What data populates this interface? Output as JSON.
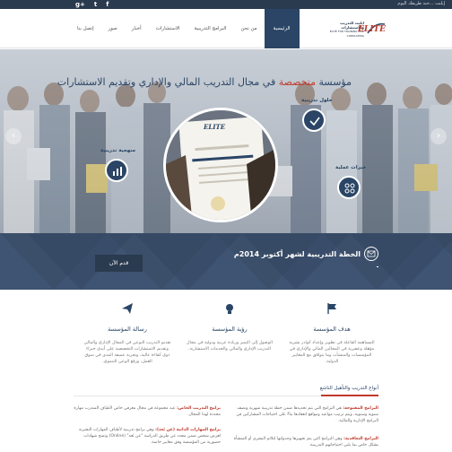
{
  "topbar": {
    "tagline": "إبلنت ...حند طريقك اليوم",
    "social": [
      "g+",
      "t",
      "f"
    ]
  },
  "header": {
    "logo_word": "ELITE",
    "logo_text_ar": "ايليت للتدريب والاستشارات",
    "logo_text_en": "ELITE FOR TRAINING AND CONSULTING"
  },
  "nav": {
    "items": [
      {
        "label": "الرئيسية",
        "active": true
      },
      {
        "label": "من نحن",
        "active": false
      },
      {
        "label": "البرامج التدريبية",
        "active": false
      },
      {
        "label": "الاستشارات",
        "active": false
      },
      {
        "label": "أخبار",
        "active": false
      },
      {
        "label": "صور",
        "active": false
      },
      {
        "label": "إتصل بنا",
        "active": false
      }
    ]
  },
  "hero": {
    "title_start": "مؤسسة ",
    "title_highlight": "متخصصة",
    "title_end": " في مجال التدريب المالي والإداري وتقديم الاستشارات",
    "features": {
      "solutions": "حلول تدريبية",
      "methodology": "منهجية تدريبية",
      "expertise": "خبرات عملية"
    },
    "prev": "‹",
    "next": "›",
    "cert_logo": "ELITE"
  },
  "band": {
    "title": "الخطة التدريبية لشهر أكتوبر 2014م",
    "button": "قدم الآن",
    "dash": "-"
  },
  "columns": [
    {
      "title": "هدف المؤسسة",
      "text": "المساهمة الفاعلة في تطوير وإعداد كوادر بشرية مؤهلة وعصرية في المجالين المالي والإداري في المؤسسات والمنشآت وما يتوافق مع المعايير الدولية."
    },
    {
      "title": "رؤية المؤسسة",
      "text": "الوصول إلى التميز وريادة عربية ودولية في مجال التدريب الإداري والمالي والخدمات الاستشارية."
    },
    {
      "title": "رسالة المؤسسة",
      "text": "تقديم التدريب النوعي في المجال الإداري والمالي وتقديم الاستشارات التخصصية على أيدي خبراء ذوي كفاءة عالية، وتجربة عميقة المدى في سوق العمل، ورفع الوعي التنموي."
    }
  ],
  "programs": {
    "title": "أنواع التدريب والتأهيل الناشع",
    "items": [
      {
        "name": "البرامج المفتوحة:",
        "text": "هي البرامج التي يتم تحديدها ضمن خطة تدريبية شهرية ونصف سنوية وسنوية، ويتم ترتيب مواعيد ومواقع انعقادها بناءً على احتياجات المشاركين في البرامج الإدارية والمالية."
      },
      {
        "name": "برامج التدريب الخاص:",
        "text": "عبد مجموعة في مجال معرفي خاص لأطياف المتدرب مهارة محددة لهذا المجال."
      },
      {
        "name": "البرامج التعاقدية:",
        "text": "وهي البرامج التي يتم تجهيزها وجدولتها لتلائم البشري أو المنشأة بشكل خاص بما يلبي احتياجاتهم التدريبية."
      },
      {
        "name": "برامج المهارات الذاتية (عن بُعد):",
        "text": "وهي برامج تدريبية لأطياف المهارات البشرية لعرض شخص ضمن محدد عن طريق الدراسة \"عن بُعد\" (Online) وتمنح شهادات حضورية من المؤسسة وفق معايير خاصة."
      }
    ]
  },
  "colors": {
    "navy": "#2a4566",
    "accent": "#c0392b",
    "band": "#3b4f6a"
  }
}
